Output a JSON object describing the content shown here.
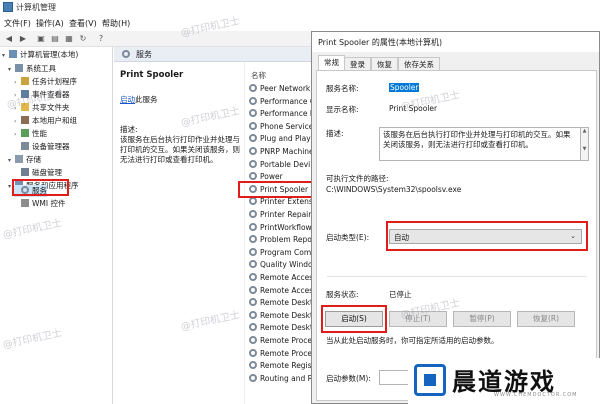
{
  "window": {
    "title": "计算机管理"
  },
  "menubar": [
    "文件(F)",
    "操作(A)",
    "查看(V)",
    "帮助(H)"
  ],
  "tree": [
    {
      "label": "计算机管理(本地)",
      "level": 0,
      "icon": "computer-icon",
      "expanded": true
    },
    {
      "label": "系统工具",
      "level": 1,
      "icon": "tools-icon",
      "expanded": true
    },
    {
      "label": "任务计划程序",
      "level": 2,
      "icon": "clock-icon"
    },
    {
      "label": "事件查看器",
      "level": 2,
      "icon": "event-icon"
    },
    {
      "label": "共享文件夹",
      "level": 2,
      "icon": "folder-icon"
    },
    {
      "label": "本地用户和组",
      "level": 2,
      "icon": "users-icon"
    },
    {
      "label": "性能",
      "level": 2,
      "icon": "performance-icon"
    },
    {
      "label": "设备管理器",
      "level": 2,
      "icon": "device-icon"
    },
    {
      "label": "存储",
      "level": 1,
      "icon": "storage-icon",
      "expanded": true
    },
    {
      "label": "磁盘管理",
      "level": 2,
      "icon": "disk-icon"
    },
    {
      "label": "服务和应用程序",
      "level": 1,
      "icon": "apps-icon",
      "expanded": true
    },
    {
      "label": "服务",
      "level": 2,
      "icon": "gear-icon",
      "selected": true
    },
    {
      "label": "WMI 控件",
      "level": 2,
      "icon": "wmi-icon"
    }
  ],
  "services_pane": {
    "header": "服务",
    "selected_name": "Print Spooler",
    "start_link": "启动",
    "start_suffix": "此服务",
    "desc_label": "描述:",
    "desc_text": "该服务在后台执行打印作业并处理与打印机的交互。如果关闭该服务，则无法进行打印或查看打印机。",
    "column_name": "名称",
    "rows": [
      "Peer Network",
      "Performance C",
      "Performance L",
      "Phone Service",
      "Plug and Play",
      "PNRP Machine",
      "Portable Devi",
      "Power",
      "Print Spooler",
      "Printer Extensi",
      "Printer Repair",
      "PrintWorkflow",
      "Problem Repor",
      "Program Comp",
      "Quality Windo",
      "Remote Access",
      "Remote Access",
      "Remote Deskt",
      "Remote Deskt",
      "Remote Deskt",
      "Remote Proce",
      "Remote Proce",
      "Remote Regis",
      "Routing and Re"
    ]
  },
  "dialog": {
    "title": "Print Spooler 的属性(本地计算机)",
    "tabs": [
      "常规",
      "登录",
      "恢复",
      "依存关系"
    ],
    "service_name_label": "服务名称:",
    "service_name_value": "Spooler",
    "display_name_label": "显示名称:",
    "display_name_value": "Print Spooler",
    "description_label": "描述:",
    "description_value": "该服务在后台执行打印作业并处理与打印机的交互。如果关闭该服务，则无法进行打印或查看打印机。",
    "exe_path_label": "可执行文件的路径:",
    "exe_path_value": "C:\\WINDOWS\\System32\\spoolsv.exe",
    "startup_type_label": "启动类型(E):",
    "startup_type_value": "自动",
    "status_label": "服务状态:",
    "status_value": "已停止",
    "buttons": {
      "start": "启动(S)",
      "stop": "停止(T)",
      "pause": "暂停(P)",
      "resume": "恢复(R)"
    },
    "hint": "当从此处启动服务时，你可指定所适用的启动参数。",
    "params_label": "启动参数(M):"
  },
  "watermark": "@打印机卫士",
  "logo": {
    "text": "晨道游戏",
    "url": "WWW.CHEMDOCTOR.COM"
  },
  "colors": {
    "highlight": "#e21b1b",
    "selection": "#0078d7",
    "logo": "#1565c0"
  }
}
